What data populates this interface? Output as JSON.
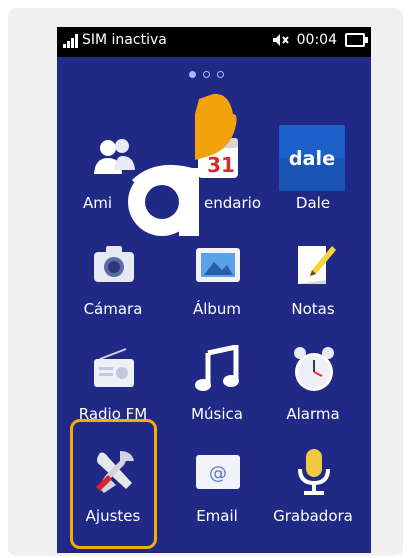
{
  "status_bar": {
    "carrier": "SIM inactiva",
    "time": "00:04",
    "icons": [
      "signal-icon",
      "mute-icon",
      "battery-icon"
    ]
  },
  "pager": {
    "pages": 3,
    "current": 1
  },
  "apps": [
    {
      "label": "Amigos",
      "icon": "friends-icon",
      "visible_label": "Ami"
    },
    {
      "label": "Calendario",
      "icon": "calendar-icon",
      "visible_label": "endario",
      "calendar_day": "31"
    },
    {
      "label": "Dale",
      "icon": "dale-icon",
      "icon_text": "dale"
    },
    {
      "label": "Cámara",
      "icon": "camera-icon"
    },
    {
      "label": "Álbum",
      "icon": "album-icon"
    },
    {
      "label": "Notas",
      "icon": "notes-icon"
    },
    {
      "label": "Radio FM",
      "icon": "radio-icon"
    },
    {
      "label": "Música",
      "icon": "music-icon"
    },
    {
      "label": "Alarma",
      "icon": "alarm-icon"
    },
    {
      "label": "Ajustes",
      "icon": "settings-icon"
    },
    {
      "label": "Email",
      "icon": "email-icon"
    },
    {
      "label": "Grabadora",
      "icon": "recorder-icon"
    }
  ],
  "colors": {
    "screen_bg": "#202a86",
    "highlight": "#f4ae00",
    "logo_orange": "#f2a20b",
    "dale_blue": "#1c5fc8"
  }
}
